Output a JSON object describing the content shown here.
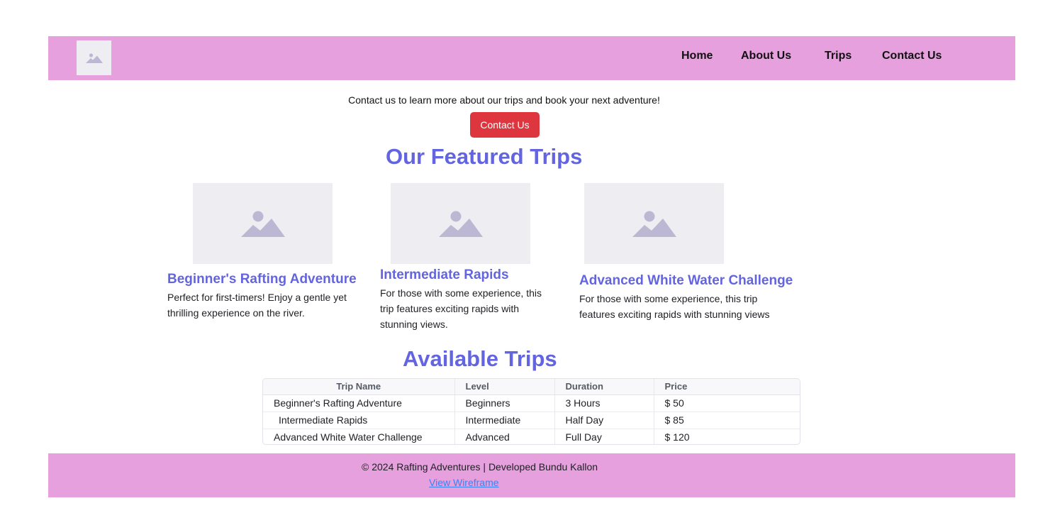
{
  "nav": {
    "items": [
      {
        "label": "Home"
      },
      {
        "label": "About Us"
      },
      {
        "label": "Trips"
      },
      {
        "label": "Contact Us"
      }
    ]
  },
  "intro": {
    "text": "Contact us to learn more about our trips and book your next adventure!",
    "button_label": "Contact Us"
  },
  "featured": {
    "heading": "Our Featured Trips",
    "cards": [
      {
        "title": "Beginner's Rafting Adventure",
        "description": "Perfect for first-timers! Enjoy a gentle yet thrilling experience on the river."
      },
      {
        "title": "Intermediate Rapids",
        "description": "For those with some experience, this trip features exciting rapids with stunning views."
      },
      {
        "title": "Advanced White Water Challenge",
        "description": "For those with some experience, this trip features exciting rapids with stunning views"
      }
    ]
  },
  "available": {
    "heading": "Available Trips",
    "columns": [
      "Trip Name",
      "Level",
      "Duration",
      "Price"
    ],
    "rows": [
      [
        "Beginner's Rafting Adventure",
        "Beginners",
        "3 Hours",
        "$ 50"
      ],
      [
        "Intermediate Rapids",
        "Intermediate",
        "Half Day",
        "$ 85"
      ],
      [
        "Advanced White Water Challenge",
        "Advanced",
        "Full Day",
        "$ 120"
      ]
    ]
  },
  "footer": {
    "copyright": "© 2024 Rafting Adventures | Developed Bundu Kallon",
    "link_label": "View Wireframe"
  },
  "colors": {
    "header_bg": "#e5a0dd",
    "accent": "#6364e0",
    "cta": "#dd363f",
    "link": "#3b82f6"
  },
  "icons": {
    "logo": "image-placeholder-icon",
    "card_image": "image-placeholder-icon"
  }
}
